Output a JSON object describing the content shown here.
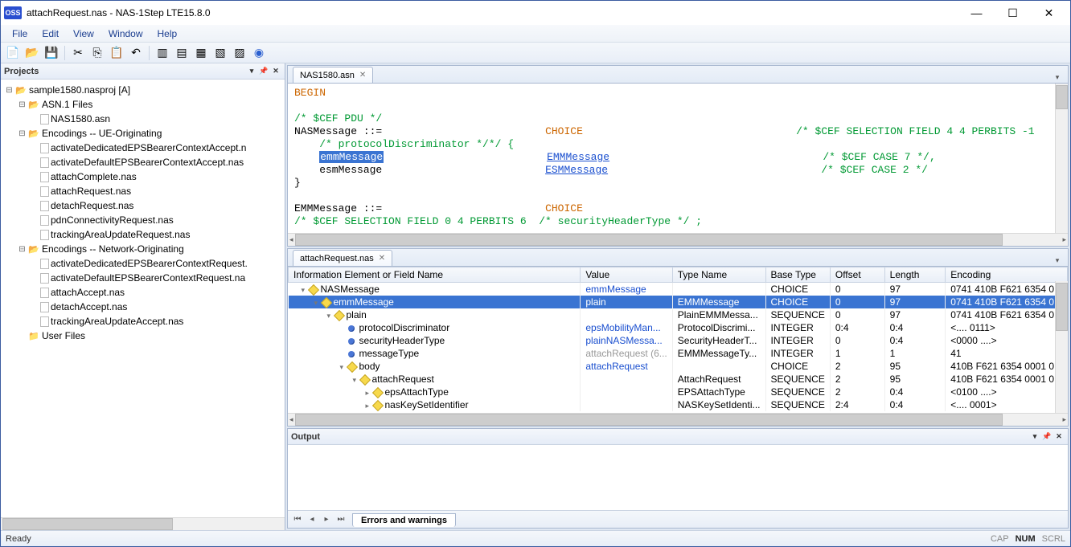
{
  "window": {
    "title": "attachRequest.nas - NAS-1Step LTE15.8.0"
  },
  "menu": {
    "file": "File",
    "edit": "Edit",
    "view": "View",
    "window": "Window",
    "help": "Help"
  },
  "toolbar_icons": [
    "new",
    "open",
    "save",
    "cut",
    "copy",
    "paste",
    "undo",
    "sep",
    "a",
    "b",
    "c",
    "d",
    "e",
    "help"
  ],
  "panel": {
    "projects_title": "Projects",
    "tree": {
      "root": "sample1580.nasproj [A]",
      "asn_folder": "ASN.1 Files",
      "asn_file": "NAS1580.asn",
      "enc_ue": "Encodings -- UE-Originating",
      "ue_files": [
        "activateDedicatedEPSBearerContextAccept.n",
        "activateDefaultEPSBearerContextAccept.nas",
        "attachComplete.nas",
        "attachRequest.nas",
        "detachRequest.nas",
        "pdnConnectivityRequest.nas",
        "trackingAreaUpdateRequest.nas"
      ],
      "enc_net": "Encodings -- Network-Originating",
      "net_files": [
        "activateDedicatedEPSBearerContextRequest.",
        "activateDefaultEPSBearerContextRequest.na",
        "attachAccept.nas",
        "detachAccept.nas",
        "trackingAreaUpdateAccept.nas"
      ],
      "user_files": "User Files"
    }
  },
  "editor": {
    "tab": "NAS1580.asn",
    "l1": "BEGIN",
    "l2": "",
    "l3": "/* $CEF PDU */",
    "l4a": "NASMessage ::=",
    "l4b": "CHOICE",
    "l4c": "/* $CEF SELECTION FIELD 4 4 PERBITS -1",
    "l5": "    /* protocolDiscriminator */*/ {",
    "l6a": "    ",
    "l6sel": "emmMessage",
    "l6b": "EMMMessage",
    "l6c": "/* $CEF CASE 7 */,",
    "l7a": "    esmMessage",
    "l7b": "ESMMessage",
    "l7c": "/* $CEF CASE 2 */",
    "l8": "}",
    "l9": "",
    "l10a": "EMMMessage ::=",
    "l10b": "CHOICE",
    "l11": "/* $CEF SELECTION FIELD 0 4 PERBITS 6  /* securityHeaderType */ ;"
  },
  "msg": {
    "tab": "attachRequest.nas",
    "headers": {
      "c1": "Information Element or Field Name",
      "c2": "Value",
      "c3": "Type Name",
      "c4": "Base Type",
      "c5": "Offset",
      "c6": "Length",
      "c7": "Encoding"
    },
    "rows": [
      {
        "indent": 0,
        "exp": "▾",
        "icon": "d",
        "name": "NASMessage",
        "value": "emmMessage",
        "vclass": "val-blue",
        "type": "",
        "base": "CHOICE",
        "off": "0",
        "len": "97",
        "enc": "0741 410B F621 6354 0..."
      },
      {
        "indent": 1,
        "exp": "▾",
        "icon": "d",
        "name": "emmMessage",
        "value": "plain",
        "vclass": "val-blue",
        "type": "EMMMessage",
        "base": "CHOICE",
        "off": "0",
        "len": "97",
        "enc": "0741 410B F621 6354 0...",
        "selected": true
      },
      {
        "indent": 2,
        "exp": "▾",
        "icon": "d",
        "name": "plain",
        "value": "",
        "vclass": "",
        "type": "PlainEMMMessa...",
        "base": "SEQUENCE",
        "off": "0",
        "len": "97",
        "enc": "0741 410B F621 6354 0..."
      },
      {
        "indent": 3,
        "exp": "",
        "icon": "b",
        "name": "protocolDiscriminator",
        "value": "epsMobilityMan...",
        "vclass": "val-blue",
        "type": "ProtocolDiscrimi...",
        "base": "INTEGER",
        "off": "0:4",
        "len": "0:4",
        "enc": "<.... 0111>"
      },
      {
        "indent": 3,
        "exp": "",
        "icon": "b",
        "name": "securityHeaderType",
        "value": "plainNASMessa...",
        "vclass": "val-blue",
        "type": "SecurityHeaderT...",
        "base": "INTEGER",
        "off": "0",
        "len": "0:4",
        "enc": "<0000 ....>"
      },
      {
        "indent": 3,
        "exp": "",
        "icon": "b",
        "name": "messageType",
        "value": "attachRequest (6...",
        "vclass": "val-gray",
        "type": "EMMMessageTy...",
        "base": "INTEGER",
        "off": "1",
        "len": "1",
        "enc": "41"
      },
      {
        "indent": 3,
        "exp": "▾",
        "icon": "d",
        "name": "body",
        "value": "attachRequest",
        "vclass": "val-blue",
        "type": "",
        "base": "CHOICE",
        "off": "2",
        "len": "95",
        "enc": "410B F621 6354 0001 0..."
      },
      {
        "indent": 4,
        "exp": "▾",
        "icon": "d",
        "name": "attachRequest",
        "value": "",
        "vclass": "",
        "type": "AttachRequest",
        "base": "SEQUENCE",
        "off": "2",
        "len": "95",
        "enc": "410B F621 6354 0001 0..."
      },
      {
        "indent": 5,
        "exp": "▸",
        "icon": "d",
        "name": "epsAttachType",
        "value": "",
        "vclass": "",
        "type": "EPSAttachType",
        "base": "SEQUENCE",
        "off": "2",
        "len": "0:4",
        "enc": "<0100 ....>"
      },
      {
        "indent": 5,
        "exp": "▸",
        "icon": "d",
        "name": "nasKeySetIdentifier",
        "value": "",
        "vclass": "",
        "type": "NASKeySetIdenti...",
        "base": "SEQUENCE",
        "off": "2:4",
        "len": "0:4",
        "enc": "<.... 0001>"
      }
    ]
  },
  "output": {
    "title": "Output",
    "tab": "Errors and warnings"
  },
  "status": {
    "left": "Ready",
    "cap": "CAP",
    "num": "NUM",
    "scrl": "SCRL"
  }
}
